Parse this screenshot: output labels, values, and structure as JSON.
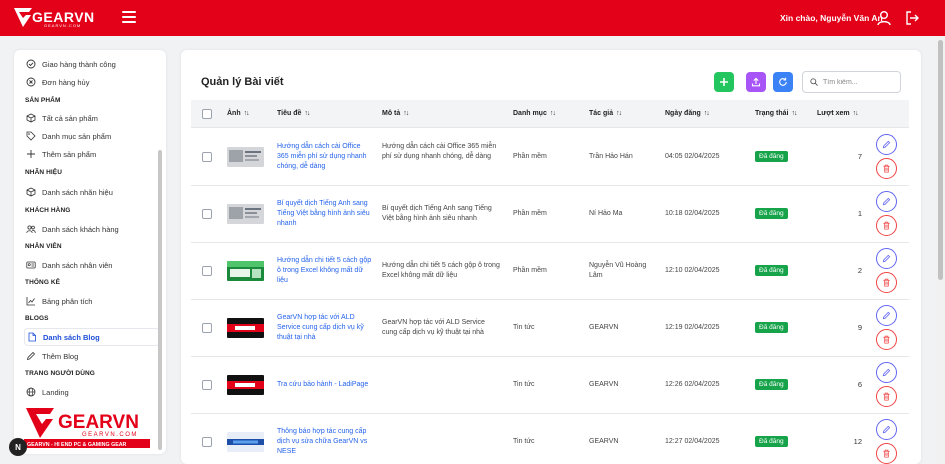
{
  "topbar": {
    "logo_text": "GEARVN",
    "logo_sub": "GEARVN.COM",
    "greeting": "Xin chào, Nguyễn Văn An"
  },
  "sidebar": {
    "items_top": [
      {
        "label": "Giao hàng thành công",
        "icon": "check-circle-icon"
      },
      {
        "label": "Đơn hàng hủy",
        "icon": "x-circle-icon"
      }
    ],
    "sections": [
      {
        "title": "SẢN PHẨM",
        "items": [
          {
            "label": "Tất cả sản phẩm",
            "icon": "box-icon"
          },
          {
            "label": "Danh mục sản phẩm",
            "icon": "tag-icon"
          },
          {
            "label": "Thêm sản phẩm",
            "icon": "plus-icon"
          }
        ]
      },
      {
        "title": "NHÃN HIỆU",
        "items": [
          {
            "label": "Danh sách nhãn hiệu",
            "icon": "box-icon"
          }
        ]
      },
      {
        "title": "KHÁCH HÀNG",
        "items": [
          {
            "label": "Danh sách khách hàng",
            "icon": "users-icon"
          }
        ]
      },
      {
        "title": "NHÂN VIÊN",
        "items": [
          {
            "label": "Danh sách nhân viên",
            "icon": "id-card-icon"
          }
        ]
      },
      {
        "title": "THỐNG KÊ",
        "items": [
          {
            "label": "Bảng phân tích",
            "icon": "chart-line-icon"
          }
        ]
      },
      {
        "title": "BLOGS",
        "items": [
          {
            "label": "Danh sách Blog",
            "icon": "document-icon"
          },
          {
            "label": "Thêm Blog",
            "icon": "pencil-icon"
          }
        ]
      },
      {
        "title": "TRANG NGƯỜI DÙNG",
        "items": [
          {
            "label": "Landing",
            "icon": "globe-icon"
          }
        ]
      }
    ],
    "brand": {
      "text": "GEARVN",
      "sub": "GEARVN.COM",
      "slogan": "GEARVN - HI END PC & GAMING GEAR"
    }
  },
  "fab_label": "N",
  "main": {
    "title": "Quản lý Bài viết",
    "search_placeholder": "Tìm kiếm...",
    "columns": {
      "image": "Ảnh",
      "title": "Tiêu đề",
      "description": "Mô tả",
      "category": "Danh mục",
      "author": "Tác giả",
      "date": "Ngày đăng",
      "status": "Trạng thái",
      "views": "Lượt xem"
    },
    "rows": [
      {
        "title": "Hướng dẫn cách cài Office 365 miễn phí sử dụng nhanh chóng, dễ dàng",
        "description": "Hướng dẫn cách cài Office 365 miễn phí sử dụng nhanh chóng, dễ dàng",
        "category": "Phần mềm",
        "author": "Trần Hảo Hán",
        "date": "04:05 02/04/2025",
        "status": "Đã đăng",
        "views": "7",
        "thumb": "gray"
      },
      {
        "title": "Bí quyết dịch Tiếng Anh sang Tiếng Việt bằng hình ảnh siêu nhanh",
        "description": "Bí quyết dịch Tiếng Anh sang Tiếng Việt bằng hình ảnh siêu nhanh",
        "category": "Phần mềm",
        "author": "Ní Hảo Ma",
        "date": "10:18 02/04/2025",
        "status": "Đã đăng",
        "views": "1",
        "thumb": "gray"
      },
      {
        "title": "Hướng dẫn chi tiết 5 cách gộp ô trong Excel không mất dữ liệu",
        "description": "Hướng dẫn chi tiết 5 cách gộp ô trong Excel không mất dữ liệu",
        "category": "Phần mềm",
        "author": "Nguyễn Vũ Hoàng Lâm",
        "date": "12:10 02/04/2025",
        "status": "Đã đăng",
        "views": "2",
        "thumb": "green"
      },
      {
        "title": "GearVN hợp tác với ALD Service cung cấp dịch vụ kỹ thuật tại nhà",
        "description": "GearVN hợp tác với ALD Service cung cấp dịch vụ kỹ thuật tại nhà",
        "category": "Tin tức",
        "author": "GEARVN",
        "date": "12:19 02/04/2025",
        "status": "Đã đăng",
        "views": "9",
        "thumb": "red"
      },
      {
        "title": "Tra cứu bảo hành - LadiPage",
        "description": "",
        "category": "Tin tức",
        "author": "GEARVN",
        "date": "12:26 02/04/2025",
        "status": "Đã đăng",
        "views": "6",
        "thumb": "red"
      },
      {
        "title": "Thông báo hợp tác cung cấp dịch vụ sửa chữa GearVN vs NESE",
        "description": "",
        "category": "Tin tức",
        "author": "GEARVN",
        "date": "12:27 02/04/2025",
        "status": "Đã đăng",
        "views": "12",
        "thumb": "blue"
      }
    ]
  },
  "colors": {
    "brand": "#e30019",
    "status_green": "#16a34a",
    "link": "#2563eb"
  }
}
